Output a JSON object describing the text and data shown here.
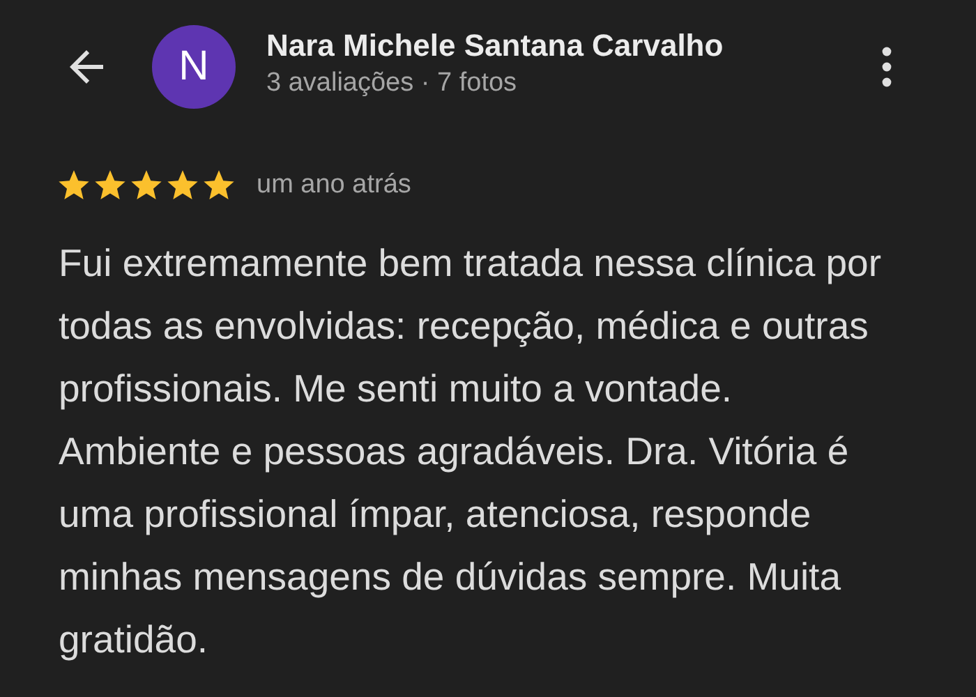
{
  "header": {
    "avatar_letter": "N",
    "name": "Nara Michele Santana Carvalho",
    "subtitle": "3 avaliações · 7 fotos"
  },
  "review": {
    "stars": 5,
    "time": "um ano atrás",
    "text": "Fui extremamente bem tratada nessa clínica por todas as envolvidas: recepção, médica e outras profissionais. Me senti muito a vontade. Ambiente e pessoas agradáveis. Dra. Vitória é uma profissional ímpar, atenciosa, responde minhas mensagens de dúvidas sempre. Muita gratidão."
  }
}
